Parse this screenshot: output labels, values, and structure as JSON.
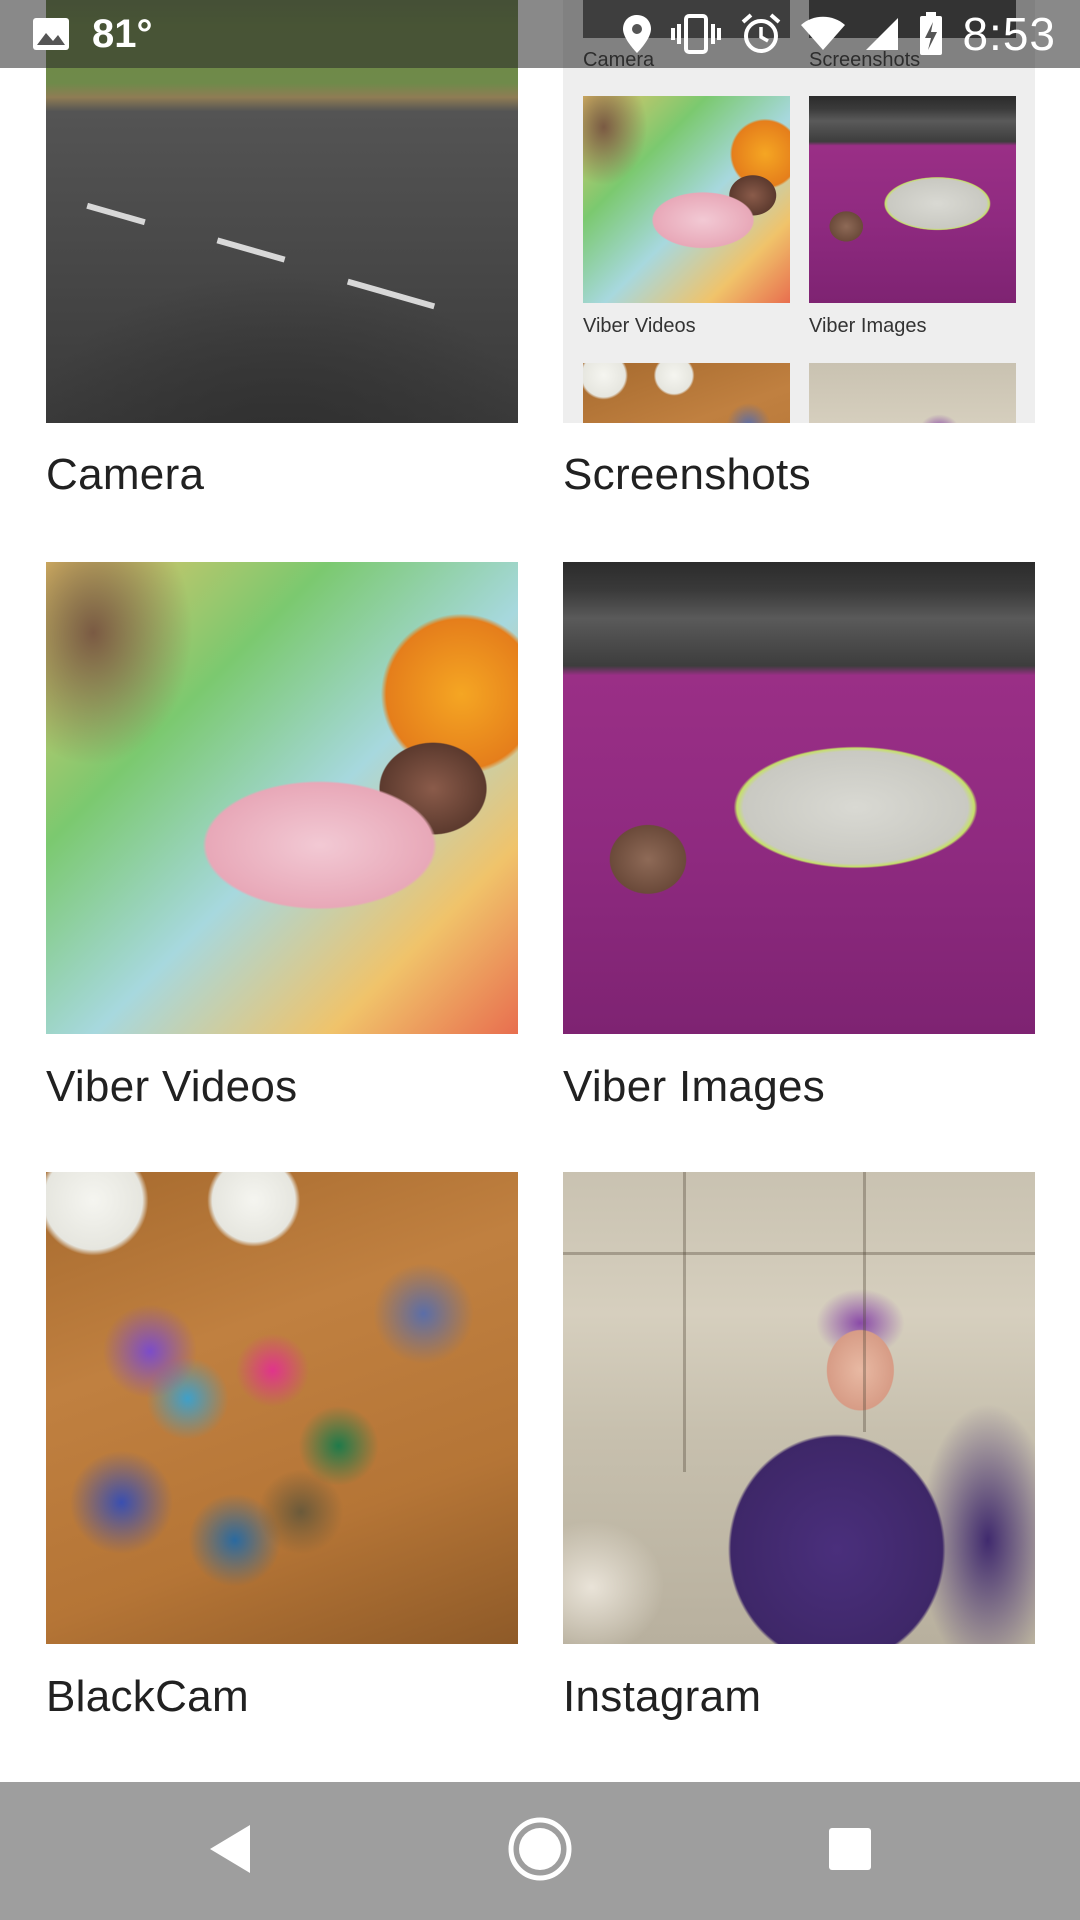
{
  "status_bar": {
    "temperature": "81°",
    "time": "8:53",
    "icons": [
      "image-icon",
      "location-icon",
      "vibrate-icon",
      "alarm-icon",
      "wifi-icon",
      "signal-icon",
      "battery-charging-icon"
    ]
  },
  "albums": [
    {
      "title": "Camera"
    },
    {
      "title": "Screenshots"
    },
    {
      "title": "Viber Videos"
    },
    {
      "title": "Viber Images"
    },
    {
      "title": "BlackCam"
    },
    {
      "title": "Instagram"
    }
  ],
  "screenshot_preview": {
    "labels": [
      "Camera",
      "Screenshots",
      "Viber Videos",
      "Viber Images"
    ]
  },
  "nav_bar": {
    "icons": [
      "back-icon",
      "home-icon",
      "recents-icon"
    ]
  }
}
